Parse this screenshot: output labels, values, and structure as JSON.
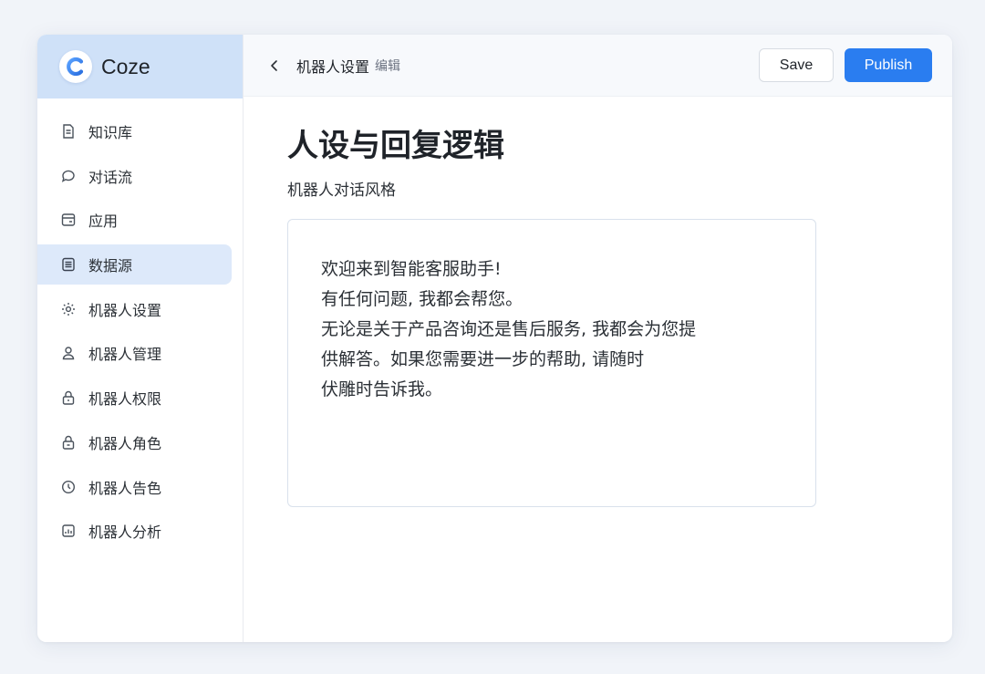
{
  "brand": {
    "name": "Coze"
  },
  "sidebar": {
    "items": [
      {
        "label": "知识库",
        "icon": "document-icon",
        "active": false
      },
      {
        "label": "对话流",
        "icon": "chat-bubble-icon",
        "active": false
      },
      {
        "label": "应用",
        "icon": "folder-icon",
        "active": false
      },
      {
        "label": "数据源",
        "icon": "list-doc-icon",
        "active": true
      },
      {
        "label": "机器人设置",
        "icon": "gear-icon",
        "active": false
      },
      {
        "label": "机器人管理",
        "icon": "user-icon",
        "active": false
      },
      {
        "label": "机器人权限",
        "icon": "lock-icon",
        "active": false
      },
      {
        "label": "机器人角色",
        "icon": "lock-icon",
        "active": false
      },
      {
        "label": "机器人告色",
        "icon": "clock-icon",
        "active": false
      },
      {
        "label": "机器人分析",
        "icon": "chart-icon",
        "active": false
      }
    ]
  },
  "header": {
    "title": "机器人设置",
    "subtitle": "编辑",
    "save_label": "Save",
    "publish_label": "Publish"
  },
  "main": {
    "page_title": "人设与回复逻辑",
    "field_label": "机器人对话风格",
    "textarea_value": "欢迎来到智能客服助手!\n有任何问题, 我都会帮您。\n无论是关于产品咨询还是售后服务, 我都会为您提\n供解答。如果您需要进一步的帮助, 请随时\n伏雕时告诉我。"
  },
  "colors": {
    "accent": "#2a7df0",
    "brand_bg": "#cfe1f8",
    "active_nav_bg": "#dde9fa"
  }
}
